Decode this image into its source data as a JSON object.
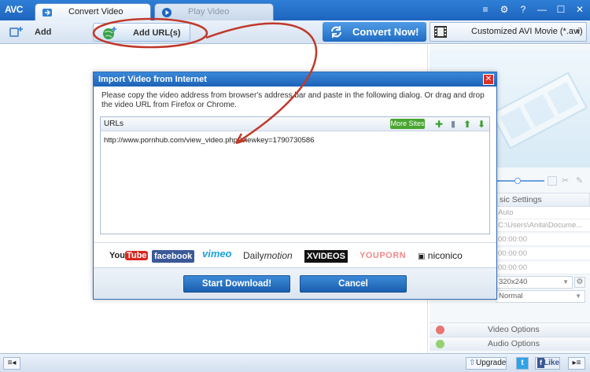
{
  "app": {
    "logo": "AVC",
    "tabs": [
      {
        "label": "Convert Video",
        "active": true
      },
      {
        "label": "Play Video",
        "active": false
      }
    ],
    "window_controls": [
      "menu-icon",
      "gear-icon",
      "help-icon",
      "minimize-icon",
      "maximize-icon",
      "close-icon"
    ],
    "window_glyphs": {
      "menu": "≡",
      "gear": "⚙",
      "help": "?",
      "minimize": "—",
      "maximize": "☐",
      "close": "✕"
    }
  },
  "toolbar": {
    "add_videos": "Add Video(s)",
    "add_urls": "Add URL(s)",
    "convert_now": "Convert Now!",
    "profile": "Customized AVI Movie (*.avi)"
  },
  "right_panel": {
    "settings_header": "sic Settings",
    "rows": [
      "Auto",
      "C:\\Users\\Anita\\Docume...",
      "00:00:00",
      "00:00:00",
      "00:00:00"
    ],
    "resolution": "320x240",
    "quality": "Normal",
    "video_options": "Video Options",
    "audio_options": "Audio Options"
  },
  "dialog": {
    "title": "Import Video from Internet",
    "description": "Please copy the video address from browser's address bar and paste in the following dialog. Or drag and drop the video URL from Firefox or Chrome.",
    "urls_header": "URLs",
    "more_sites": "More Sites",
    "url_value": "http://www.pornhub.com/view_video.php?viewkey=1790730586",
    "brands": {
      "youtube_a": "You",
      "youtube_b": "Tube",
      "facebook": "facebook",
      "vimeo": "vimeo",
      "dailymotion_a": "Daily",
      "dailymotion_b": "motion",
      "xvideos": "XVIDEOS",
      "youporn": "YOUPORN",
      "niconico": "niconico"
    },
    "start_download": "Start Download!",
    "cancel": "Cancel"
  },
  "statusbar": {
    "upgrade": "Upgrade",
    "like": "Like",
    "twitter_glyph": "t"
  },
  "colors": {
    "accent_blue": "#1d64bf",
    "annotation_red": "#c0392b",
    "more_sites_green": "#4aa532"
  }
}
